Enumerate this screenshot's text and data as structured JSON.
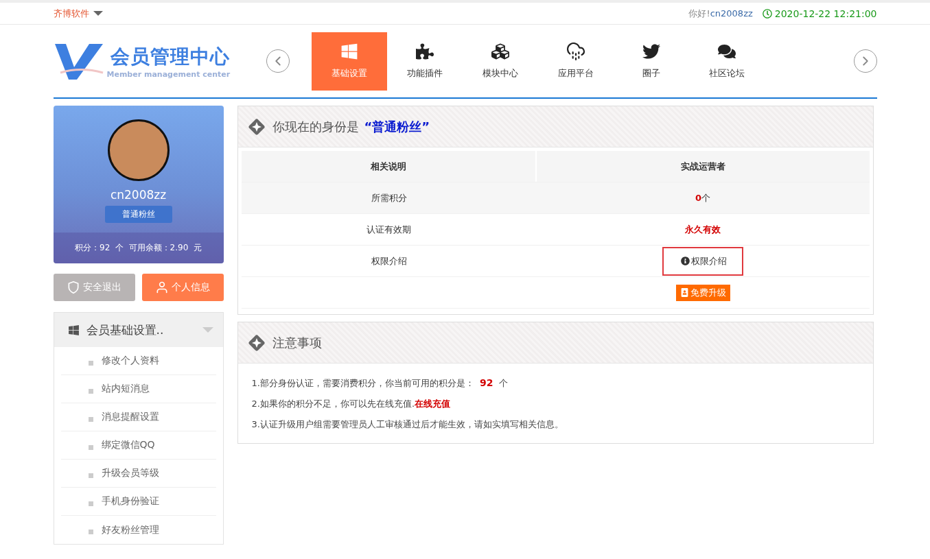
{
  "top_bar": {
    "site_menu": "齐博软件",
    "greeting": "你好!",
    "username": "cn2008zz",
    "datetime": "2020-12-22 12:21:00"
  },
  "logo": {
    "title": "会员管理中心",
    "subtitle": "Member management center"
  },
  "nav": [
    {
      "label": "基础设置",
      "selected": true
    },
    {
      "label": "功能插件",
      "selected": false
    },
    {
      "label": "模块中心",
      "selected": false
    },
    {
      "label": "应用平台",
      "selected": false
    },
    {
      "label": "圈子",
      "selected": false
    },
    {
      "label": "社区论坛",
      "selected": false
    }
  ],
  "profile": {
    "name": "cn2008zz",
    "group": "普通粉丝",
    "stats": "积分：92  个  可用余额：2.90  元"
  },
  "buttons": [
    {
      "label": "安全退出",
      "kind": "logout"
    },
    {
      "label": "个人信息",
      "kind": "profile"
    }
  ],
  "menu": {
    "title": "会员基础设置..",
    "expanded": true,
    "items": [
      "修改个人资料",
      "站内短消息",
      "消息提醒设置",
      "绑定微信QQ",
      "升级会员等级",
      "手机身份验证",
      "好友粉丝管理"
    ]
  },
  "identity_panel": {
    "title": "你现在的身份是",
    "group": "“普通粉丝”",
    "table": {
      "columns": [
        "相关说明",
        "实战运营者"
      ],
      "rows": [
        {
          "label": "所需积分",
          "kind": "count",
          "value": "0",
          "unit": "个"
        },
        {
          "label": "认证有效期",
          "kind": "emphasis",
          "value": "永久有效"
        },
        {
          "label": "权限介绍",
          "kind": "info",
          "value": "权限介绍",
          "highlighted": true
        },
        {
          "kind": "button",
          "value": "免费升级"
        }
      ]
    }
  },
  "notes_panel": {
    "title": "注意事项",
    "notes": [
      {
        "text": "1.部分身份认证，需要消费积分，你当前可用的积分是： **92** 个"
      },
      {
        "text": "2.如果你的积分不足，你可以先在线充值.",
        "link": "在线充值"
      },
      {
        "text": "3.认证升级用户组需要管理员人工审核通过后才能生效，请如实填写相关信息。"
      }
    ]
  }
}
